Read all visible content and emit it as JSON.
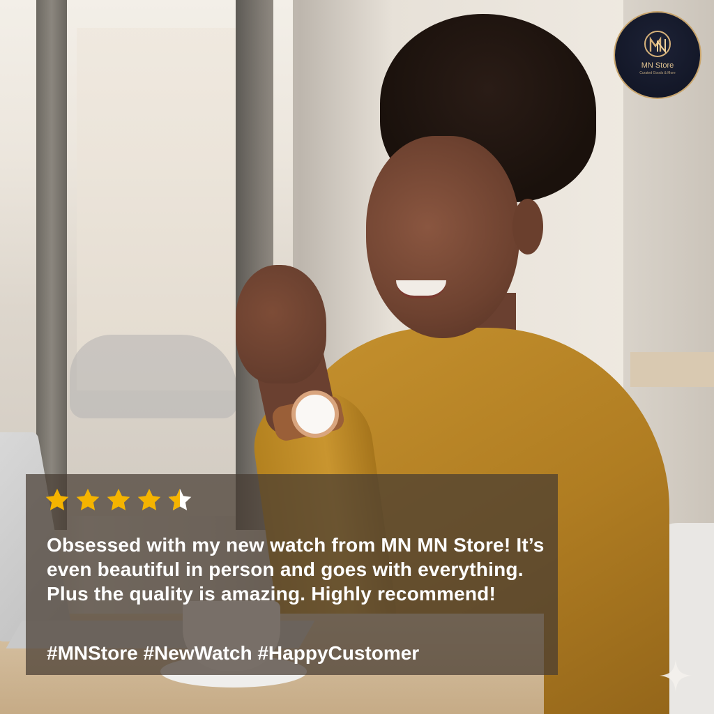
{
  "brand": {
    "name": "MN Store",
    "tagline": "Curated Goods & More",
    "accent_color": "#c9a46a",
    "logo_background": "#141a2b"
  },
  "review": {
    "rating": 4.5,
    "max_rating": 5,
    "star_color": "#f5b400",
    "text": "Obsessed with my new watch from MN MN Store! It’s even beautiful in person and goes with everything. Plus the quality is amazing. Highly recommend!",
    "hashtags": "#MNStore #NewWatch #HappyCustomer"
  },
  "icons": {
    "star": "star-icon",
    "half_star": "half-star-icon",
    "sparkle": "sparkle-icon"
  }
}
